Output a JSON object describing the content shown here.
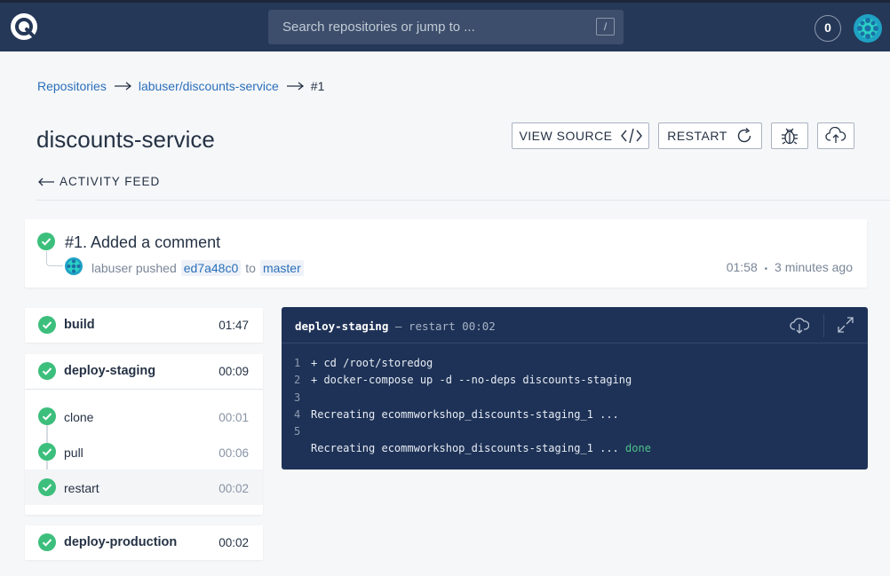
{
  "header": {
    "search_placeholder": "Search repositories or jump to ...",
    "search_shortcut": "/",
    "notification_count": "0"
  },
  "breadcrumb": {
    "repositories": "Repositories",
    "repo": "labuser/discounts-service",
    "current": "#1"
  },
  "page": {
    "title": "discounts-service",
    "view_source_label": "VIEW SOURCE",
    "restart_label": "RESTART",
    "activity_feed_label": "ACTIVITY FEED"
  },
  "commit": {
    "title": "#1. Added a comment",
    "author": "labuser",
    "action": "pushed",
    "sha": "ed7a48c0",
    "preposition": "to",
    "branch": "master",
    "time": "01:58",
    "separator": "•",
    "relative_time": "3 minutes ago"
  },
  "jobs": [
    {
      "name": "build",
      "duration": "01:47",
      "status": "success"
    },
    {
      "name": "deploy-staging",
      "duration": "00:09",
      "status": "success",
      "steps": [
        {
          "name": "clone",
          "duration": "00:01"
        },
        {
          "name": "pull",
          "duration": "00:06"
        },
        {
          "name": "restart",
          "duration": "00:02"
        }
      ]
    },
    {
      "name": "deploy-production",
      "duration": "00:02",
      "status": "success"
    }
  ],
  "log": {
    "job": "deploy-staging",
    "dash": "—",
    "step": "restart",
    "duration": "00:02",
    "lines": [
      {
        "num": "1",
        "text": "+ cd /root/storedog"
      },
      {
        "num": "2",
        "text": "+ docker-compose up -d --no-deps discounts-staging"
      },
      {
        "num": "3",
        "text": ""
      },
      {
        "num": "4",
        "text": "Recreating ecommworkshop_discounts-staging_1 ..."
      },
      {
        "num": "5",
        "text": ""
      },
      {
        "num": "",
        "text": "Recreating ecommworkshop_discounts-staging_1 ... ",
        "suffix": "done"
      }
    ]
  },
  "colors": {
    "topbar": "#253858",
    "success": "#3cbf7c",
    "link": "#2a6fba",
    "log_bg": "#1e3257"
  }
}
